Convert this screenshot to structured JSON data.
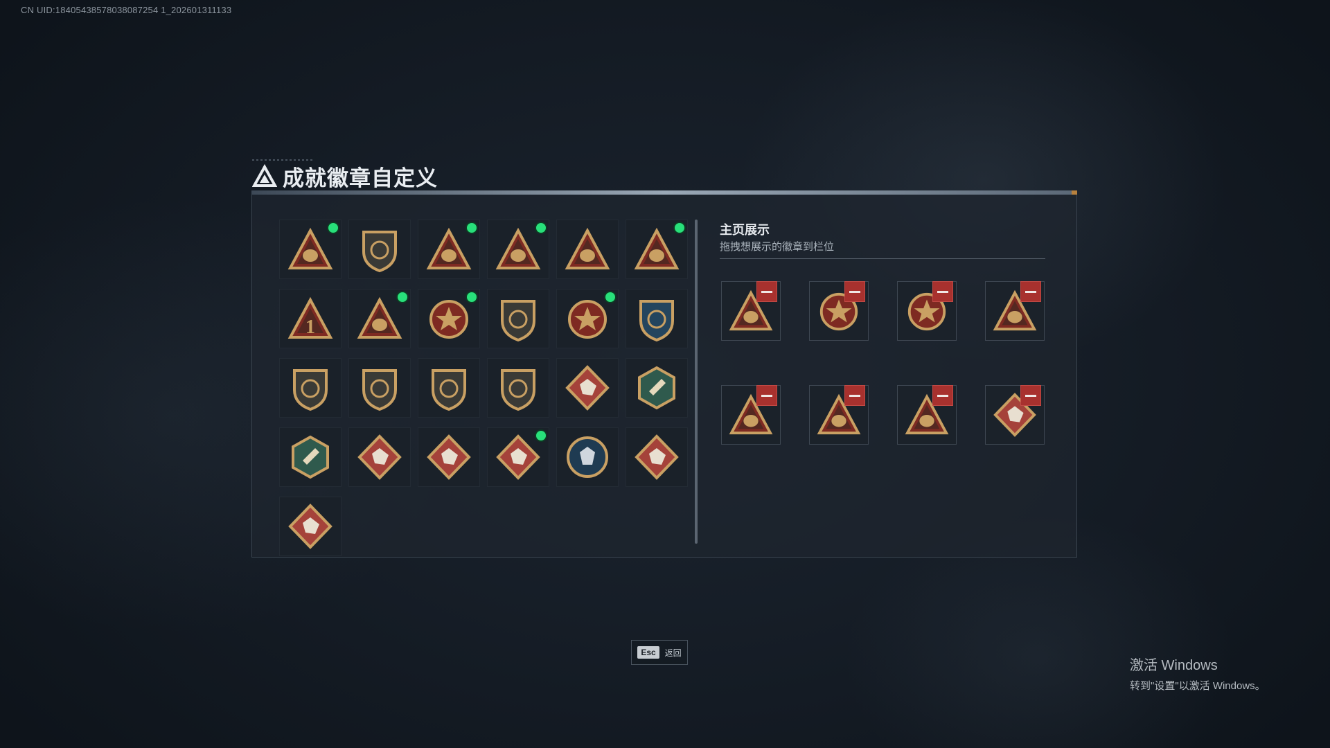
{
  "uid_text": "CN UID:18405438578038087254 1_202601311133",
  "page_title": "成就徽章自定义",
  "showcase": {
    "title": "主页展示",
    "subtitle": "拖拽想展示的徽章到栏位"
  },
  "esc": {
    "key": "Esc",
    "label": "返回"
  },
  "watermark": {
    "line1": "激活 Windows",
    "line2": "转到\"设置\"以激活 Windows。"
  },
  "colors": {
    "accent_green": "#28e07a",
    "remove_red": "#a8312e",
    "accent_orange": "#b7813e"
  },
  "badges": [
    {
      "icon": "shield-triangle-badge-icon",
      "new": true
    },
    {
      "icon": "helicopter-shield-badge-icon",
      "new": false
    },
    {
      "icon": "radar-triangle-badge-icon",
      "new": true
    },
    {
      "icon": "backpack-55-triangle-badge-icon",
      "new": true
    },
    {
      "icon": "bull-56-triangle-badge-icon",
      "new": false
    },
    {
      "icon": "tank-triangle-badge-icon",
      "new": true
    },
    {
      "icon": "number-1-triangle-badge-icon",
      "new": false
    },
    {
      "icon": "box-triangle-badge-icon",
      "new": true
    },
    {
      "icon": "star-medal-badge-icon",
      "new": true
    },
    {
      "icon": "bear-shield-badge-icon",
      "new": false
    },
    {
      "icon": "stars-crest-badge-icon",
      "new": true
    },
    {
      "icon": "crosshair-shield-blue-badge-icon",
      "new": false
    },
    {
      "icon": "rifle-shield-badge-icon",
      "new": false
    },
    {
      "icon": "rifle-shield-2-badge-icon",
      "new": false
    },
    {
      "icon": "rifle-shield-3-badge-icon",
      "new": false
    },
    {
      "icon": "crosshair-shield-gold-badge-icon",
      "new": false
    },
    {
      "icon": "wolf-diamond-badge-icon",
      "new": false
    },
    {
      "icon": "wasp-hexagon-badge-icon",
      "new": false
    },
    {
      "icon": "grenade-hexagon-badge-icon",
      "new": false
    },
    {
      "icon": "dragon-diamond-badge-icon",
      "new": false
    },
    {
      "icon": "dragon-diamond-2-badge-icon",
      "new": false
    },
    {
      "icon": "runner-diamond-badge-icon",
      "new": true
    },
    {
      "icon": "wolf-circle-badge-icon",
      "new": false
    },
    {
      "icon": "horse-diamond-badge-icon",
      "new": false
    },
    {
      "icon": "skill-diamond-badge-icon",
      "new": false
    }
  ],
  "display_slots": [
    {
      "icon": "box-triangle-badge-icon"
    },
    {
      "icon": "star-medal-badge-icon"
    },
    {
      "icon": "stars-crest-badge-icon"
    },
    {
      "icon": "tank-triangle-badge-icon"
    },
    {
      "icon": "backpack-55-triangle-badge-icon"
    },
    {
      "icon": "radar-triangle-badge-icon"
    },
    {
      "icon": "shield-triangle-badge-icon"
    },
    {
      "icon": "runner-diamond-badge-icon"
    }
  ]
}
